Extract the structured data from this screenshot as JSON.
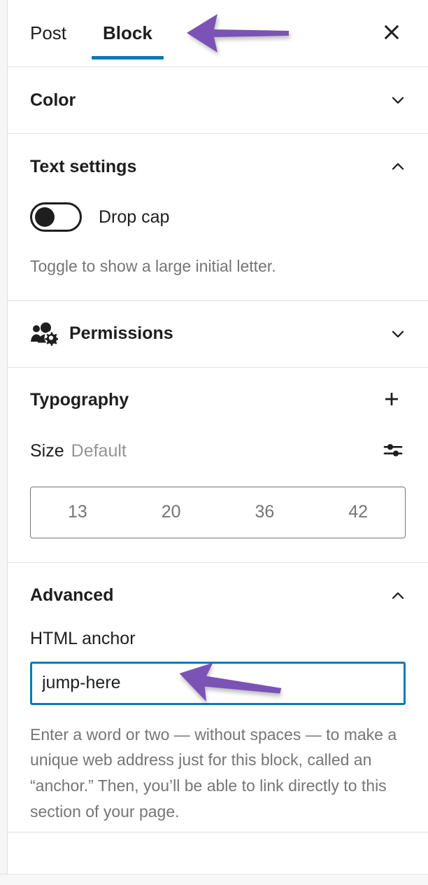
{
  "colors": {
    "accent_blue": "#0b7ab5",
    "annotation_purple": "#7b52b5",
    "text_primary": "#1e1e1e",
    "text_muted": "#757575",
    "border": "#e0e0e0"
  },
  "header": {
    "tabs": [
      {
        "label": "Post",
        "active": false
      },
      {
        "label": "Block",
        "active": true
      }
    ],
    "close_label": "Close settings",
    "close_icon": "close-icon"
  },
  "sections": {
    "color": {
      "title": "Color",
      "expanded": false,
      "chevron_icon": "chevron-down-icon"
    },
    "text_settings": {
      "title": "Text settings",
      "expanded": true,
      "chevron_icon": "chevron-up-icon",
      "drop_cap": {
        "label": "Drop cap",
        "checked": false,
        "help": "Toggle to show a large initial letter."
      }
    },
    "permissions": {
      "title": "Permissions",
      "expanded": false,
      "lead_icon": "users-gear-icon",
      "chevron_icon": "chevron-down-icon"
    },
    "typography": {
      "title": "Typography",
      "add_icon": "plus-icon",
      "add_label": "Add typography option",
      "size": {
        "label": "Size",
        "value": "Default",
        "settings_icon": "sliders-icon",
        "presets": [
          {
            "label": "13",
            "selected": false
          },
          {
            "label": "20",
            "selected": false
          },
          {
            "label": "36",
            "selected": false
          },
          {
            "label": "42",
            "selected": false
          }
        ]
      }
    },
    "advanced": {
      "title": "Advanced",
      "expanded": true,
      "chevron_icon": "chevron-up-icon",
      "html_anchor": {
        "label": "HTML anchor",
        "value": "jump-here",
        "placeholder": "",
        "focused": true,
        "help": "Enter a word or two — without spaces — to make a unique web address just for this block, called an “anchor.” Then, you’ll be able to link directly to this section of your page."
      }
    }
  },
  "annotations": [
    {
      "name": "arrow-pointing-at-block-tab",
      "target": "Block tab"
    },
    {
      "name": "arrow-pointing-at-html-anchor",
      "target": "HTML anchor field"
    }
  ]
}
